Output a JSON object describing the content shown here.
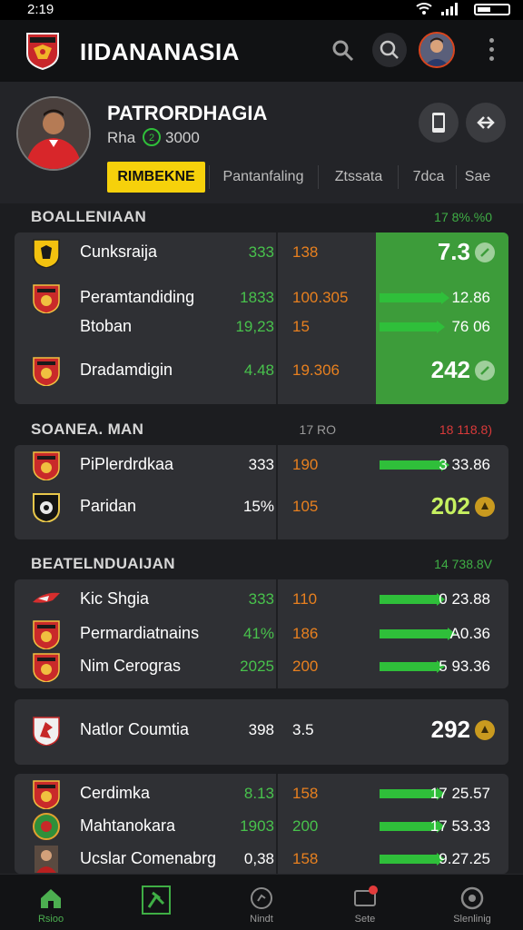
{
  "status_bar": {
    "time": "2:19"
  },
  "app_bar": {
    "title": "IIDANANASIA",
    "icons": [
      "search-icon",
      "search-icon",
      "avatar",
      "more-vertical-icon"
    ]
  },
  "profile": {
    "name": "PATRORDHAGIA",
    "sub": "Rha",
    "coins": "3000"
  },
  "tabs": [
    {
      "label": "RIMBEKNE",
      "active": true
    },
    {
      "label": "Pantanfaling",
      "active": false
    },
    {
      "label": "Ztssata",
      "active": false
    },
    {
      "label": "7dca",
      "active": false
    },
    {
      "label": "Sae",
      "active": false
    }
  ],
  "sections": [
    {
      "label": "BOALLENIAAN",
      "meta": "17 8%.%0",
      "meta_color": "#3fae45",
      "rows": [
        {
          "team": "Cunksraija",
          "v1": "333",
          "v1_color": "#48c24c",
          "v2": "138",
          "big": "7.3",
          "badge": "check",
          "crest": "yellow"
        },
        {
          "team": "Peramtandiding",
          "v1": "1833",
          "v1_color": "#48c24c",
          "v2": "100.305",
          "bar": 0.45,
          "v3": "12.86",
          "crest": "red"
        },
        {
          "team": "Btoban",
          "v1": "19,23",
          "v1_color": "#48c24c",
          "v2": "15",
          "bar": 0.42,
          "v3": "76 06",
          "crest": "none"
        },
        {
          "team": "Dradamdigin",
          "v1": "4.48",
          "v1_color": "#48c24c",
          "v2": "19.306",
          "big": "242",
          "badge": "check",
          "crest": "red"
        }
      ]
    },
    {
      "label": "SOANEA. MAN",
      "meta": "18 118.8)",
      "meta_color": "#d93a3a",
      "meta_mid": "17 RO",
      "rows": [
        {
          "team": "PiPlerdrdkaa",
          "v1": "333",
          "v1_color": "#ffffff",
          "v2": "190",
          "bar": 0.45,
          "v3": "3 33.86",
          "crest": "red"
        },
        {
          "team": "Paridan",
          "v1": "15%",
          "v1_color": "#ffffff",
          "v2": "105",
          "big": "202",
          "big_color": "#c6f060",
          "badge": "star",
          "crest": "black"
        }
      ]
    },
    {
      "label": "BEATELNDUAIJAN",
      "meta": "14 738.8V",
      "meta_color": "#3fae45",
      "rows": [
        {
          "team": "Kic Shgia",
          "v1": "333",
          "v1_color": "#48c24c",
          "v2": "110",
          "bar": 0.42,
          "v3": "0 23.88",
          "crest": "bird"
        },
        {
          "team": "Permardiatnains",
          "v1": "41%",
          "v1_color": "#48c24c",
          "v2": "186",
          "bar": 0.5,
          "v3": "A0.36",
          "crest": "red"
        },
        {
          "team": "Nim Cerogras",
          "v1": "2025",
          "v1_color": "#48c24c",
          "v2": "200",
          "bar": 0.42,
          "v3": "5 93.36",
          "crest": "red"
        }
      ]
    },
    {
      "label": "",
      "rows": [
        {
          "team": "Natlor Coumtia",
          "v1": "398",
          "v1_color": "#ffffff",
          "v2": "3.5",
          "v2_color": "#ffffff",
          "big": "292",
          "badge": "star",
          "crest": "white"
        }
      ]
    },
    {
      "label": "",
      "rows": [
        {
          "team": "Cerdimka",
          "v1": "8.13",
          "v1_color": "#48c24c",
          "v2": "158",
          "bar": 0.42,
          "v3": "17 25.57",
          "crest": "red"
        },
        {
          "team": "Mahtanokara",
          "v1": "1903",
          "v1_color": "#48c24c",
          "v2": "200",
          "v2_color": "#48c24c",
          "bar": 0.42,
          "v3": "17 53.33",
          "crest": "green"
        },
        {
          "team": "Ucslar Comenabrg",
          "v1": "0,38",
          "v1_color": "#ffffff",
          "v2": "158",
          "bar": 0.42,
          "v3": "9.27.25",
          "crest": "person"
        }
      ]
    }
  ],
  "bottom_nav": [
    {
      "label": "Rsioo",
      "icon": "home-icon",
      "active": true
    },
    {
      "label": "",
      "icon": "football-icon",
      "active": false
    },
    {
      "label": "Nindt",
      "icon": "clock-icon",
      "active": false
    },
    {
      "label": "Sete",
      "icon": "inbox-icon",
      "active": false
    },
    {
      "label": "Slenlinig",
      "icon": "settings-icon",
      "active": false
    }
  ]
}
